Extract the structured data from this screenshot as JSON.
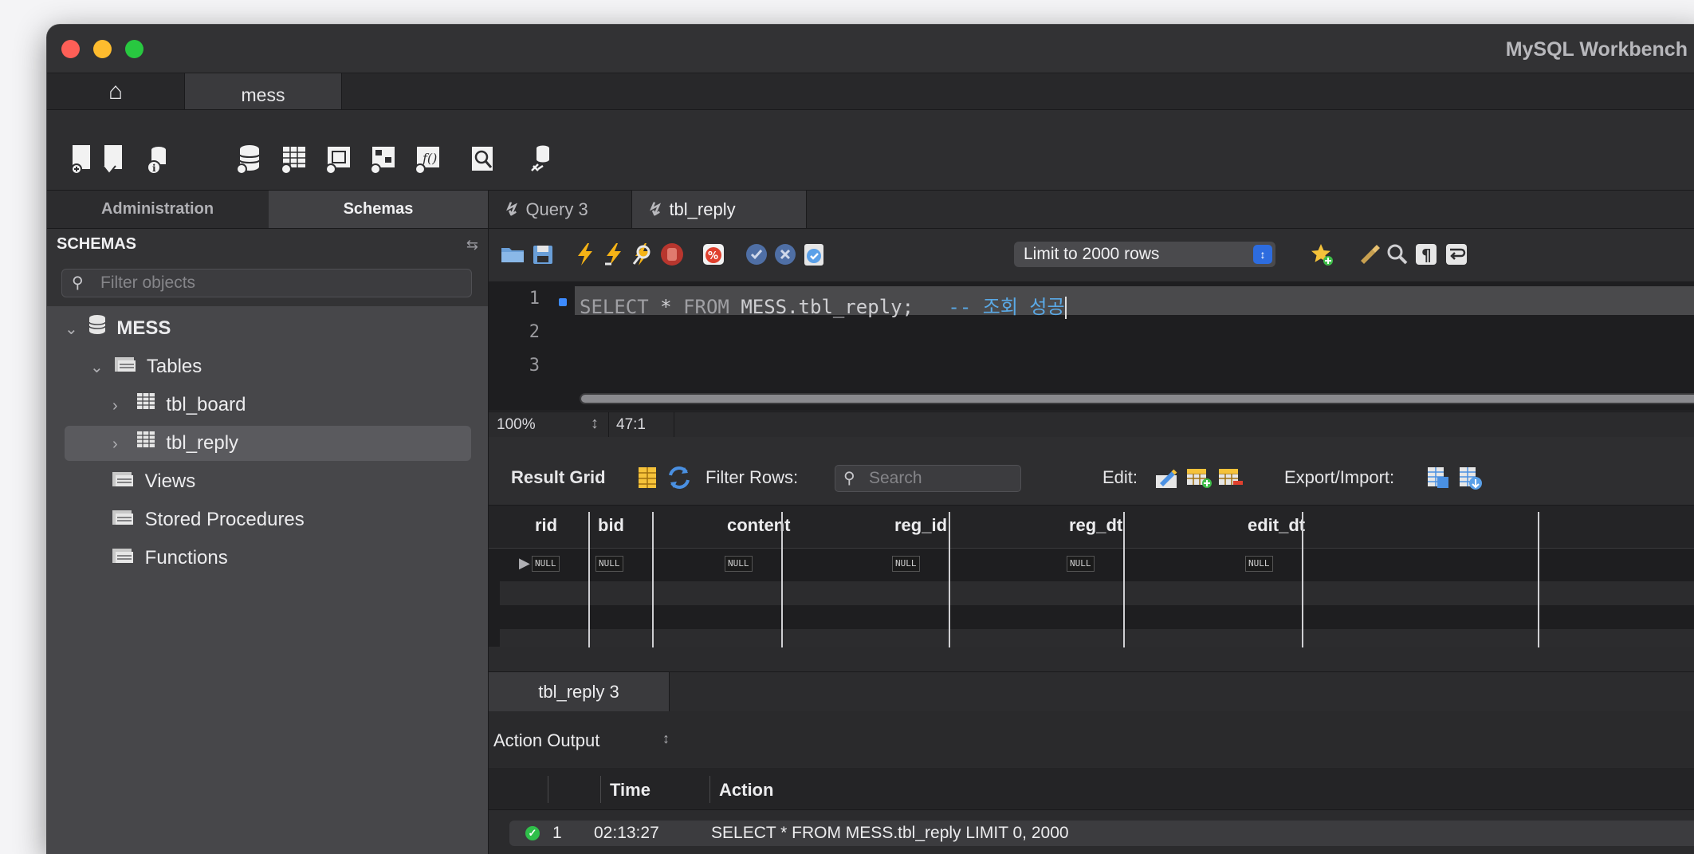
{
  "window": {
    "title": "MySQL Workbench"
  },
  "connection_tabs": [
    {
      "label": "mess"
    }
  ],
  "sidebar": {
    "tabs": [
      {
        "label": "Administration"
      },
      {
        "label": "Schemas"
      }
    ],
    "header": "SCHEMAS",
    "filter_placeholder": "Filter objects",
    "tree": {
      "schema": "MESS",
      "tables_label": "Tables",
      "tables": [
        {
          "name": "tbl_board"
        },
        {
          "name": "tbl_reply"
        }
      ],
      "views_label": "Views",
      "procedures_label": "Stored Procedures",
      "functions_label": "Functions"
    }
  },
  "query_tabs": [
    {
      "label": "Query 3"
    },
    {
      "label": "tbl_reply"
    }
  ],
  "query_toolbar": {
    "limit_label": "Limit to 2000 rows"
  },
  "editor": {
    "line_numbers": [
      "1",
      "2",
      "3"
    ],
    "keyword_select": "SELECT",
    "star": "*",
    "keyword_from": "FROM",
    "table_ref": "MESS.tbl_reply;",
    "comment": "-- 조회 성공"
  },
  "status_bar": {
    "zoom": "100%",
    "position": "47:1"
  },
  "result_toolbar": {
    "result_grid_label": "Result Grid",
    "filter_rows_label": "Filter Rows:",
    "search_placeholder": "Search",
    "edit_label": "Edit:",
    "export_import_label": "Export/Import:"
  },
  "result_grid": {
    "columns": [
      "rid",
      "bid",
      "content",
      "reg_id",
      "reg_dt",
      "edit_dt"
    ],
    "null_label": "NULL"
  },
  "output_tabs": [
    {
      "label": "tbl_reply 3"
    }
  ],
  "output": {
    "selector_label": "Action Output",
    "columns": {
      "time": "Time",
      "action": "Action"
    },
    "rows": [
      {
        "num": "1",
        "time": "02:13:27",
        "action": "SELECT * FROM MESS.tbl_reply LIMIT 0, 2000"
      }
    ]
  }
}
